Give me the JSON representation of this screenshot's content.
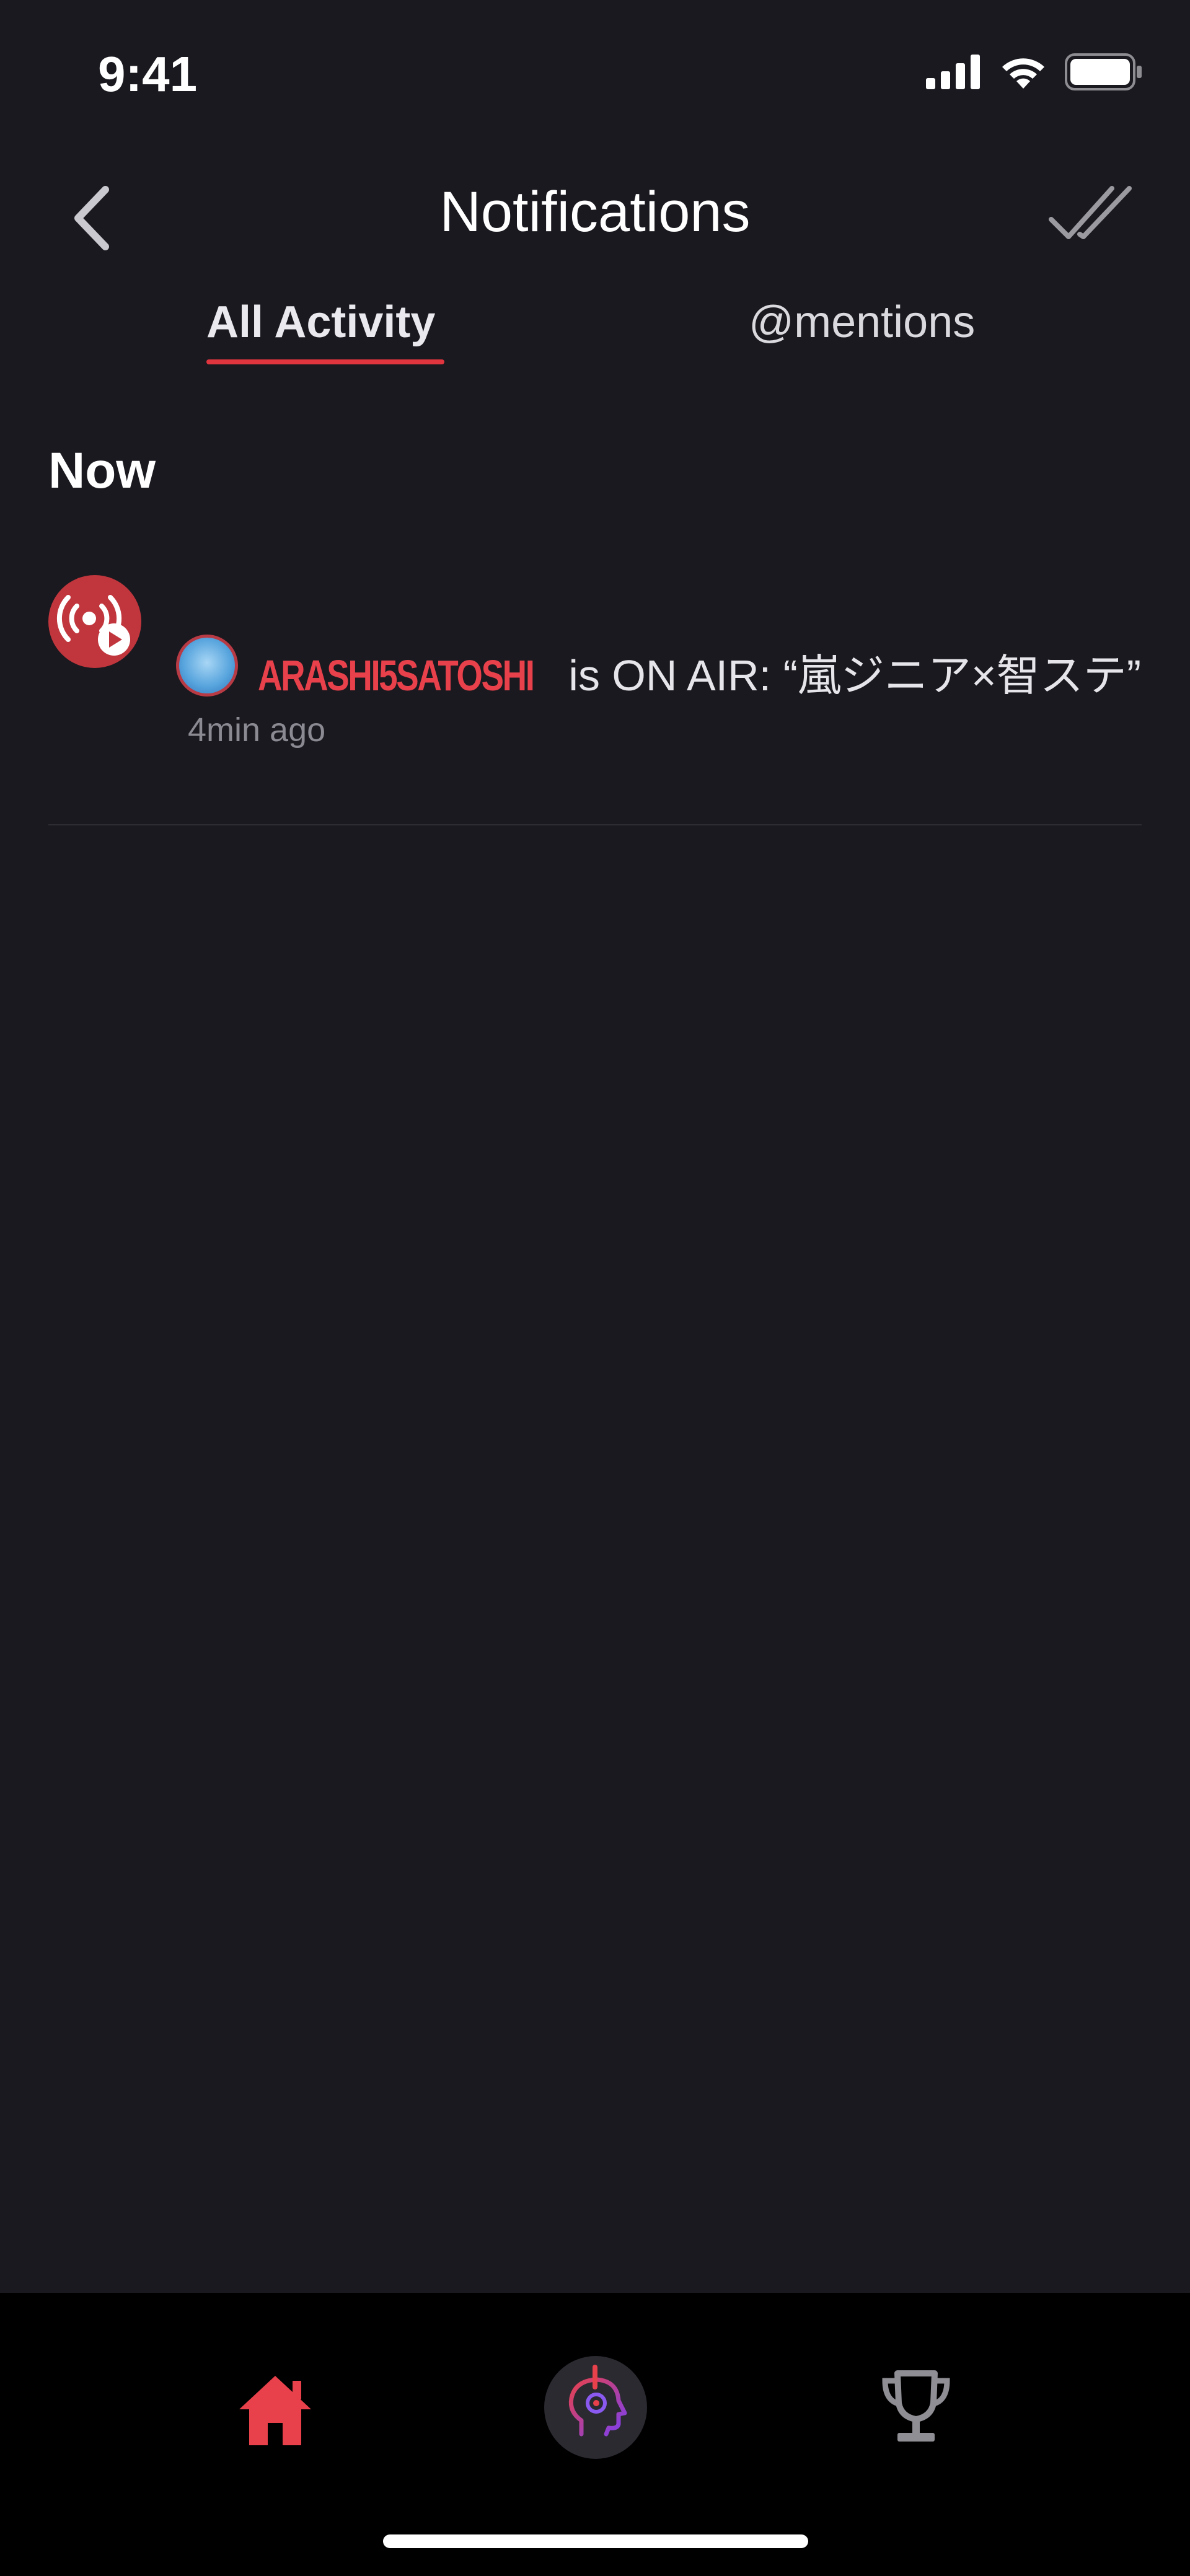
{
  "status_bar": {
    "time": "9:41",
    "icons": [
      "signal-icon",
      "wifi-icon",
      "battery-icon"
    ]
  },
  "header": {
    "title": "Notifications",
    "back_icon": "chevron-left-icon",
    "mark_read_icon": "double-check-icon"
  },
  "tabs": [
    {
      "label": "All Activity",
      "active": true
    },
    {
      "label": "@mentions",
      "active": false
    }
  ],
  "sections": [
    {
      "title": "Now",
      "items": [
        {
          "icon": "live-broadcast-icon",
          "username": "ARASHI5SATOSHI",
          "message": " is ON AIR: “嵐ジニア×智ステ”",
          "time": "4min ago"
        }
      ]
    }
  ],
  "tab_bar": {
    "items": [
      "home-icon",
      "listener-head-icon",
      "trophy-icon"
    ],
    "active": "home-icon"
  },
  "colors": {
    "background": "#1a191f",
    "accent": "#e8414b",
    "tab_bar": "#000000",
    "muted_text": "#8b8a92"
  }
}
